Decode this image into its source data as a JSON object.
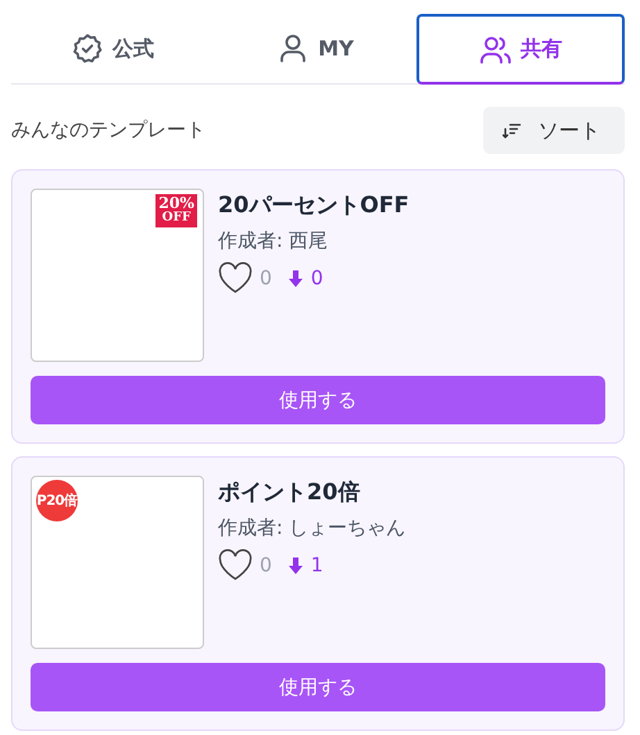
{
  "tabs": [
    {
      "label": "公式",
      "kind": "official",
      "selected": false
    },
    {
      "label": "MY",
      "kind": "personal",
      "selected": false
    },
    {
      "label": "共有",
      "kind": "shared",
      "selected": true
    }
  ],
  "section_title": "みんなのテンプレート",
  "sort_button": "ソート",
  "templates": [
    {
      "title": "20パーセントOFF",
      "author": "作成者: 西尾",
      "likes": "0",
      "downloads": "0",
      "badge": {
        "kind": "square",
        "lines": [
          "20%",
          "OFF"
        ]
      },
      "button": "使用する"
    },
    {
      "title": "ポイント20倍",
      "author": "作成者: しょーちゃん",
      "likes": "0",
      "downloads": "1",
      "badge": {
        "kind": "circle",
        "lines": [
          "P20倍"
        ]
      },
      "button": "使用する"
    }
  ]
}
